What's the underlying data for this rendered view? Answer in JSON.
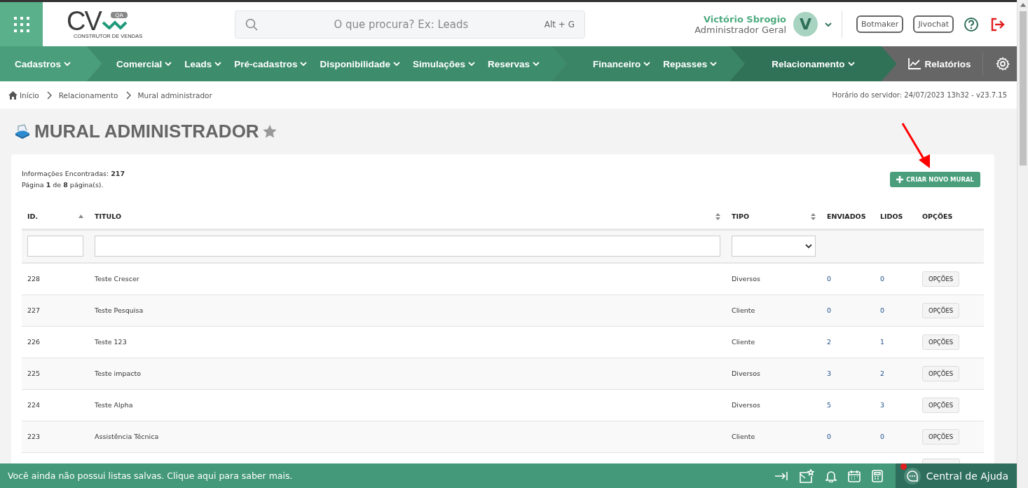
{
  "header": {
    "logo": {
      "mark": "CV",
      "badge": "QA",
      "tagline": "CONSTRUTOR DE VENDAS"
    },
    "search": {
      "placeholder": "O que procura? Ex: Leads",
      "shortcut": "Alt + G"
    },
    "user": {
      "name": "Victório Sbrogio",
      "role": "Administrador Geral",
      "initial": "V"
    },
    "buttons": [
      "Botmaker",
      "Jivochat"
    ]
  },
  "nav": {
    "groups": [
      {
        "items": [
          "Cadastros"
        ]
      },
      {
        "items": [
          "Comercial",
          "Leads",
          "Pré-cadastros",
          "Disponibilidade",
          "Simulações",
          "Reservas"
        ]
      },
      {
        "items": [
          "Financeiro",
          "Repasses"
        ]
      },
      {
        "items": [
          "Relacionamento"
        ]
      }
    ],
    "reports": "Relatórios"
  },
  "breadcrumb": [
    "Início",
    "Relacionamento",
    "Mural administrador"
  ],
  "server_time": "Horário do servidor: 24/07/2023 13h32 - v23.7.15",
  "page": {
    "title": "MURAL ADMINISTRADOR"
  },
  "summary": [
    "Informações Encontradas: **217**",
    "Página **1** de **8** página(s)."
  ],
  "create_button": "CRIAR NOVO MURAL",
  "table": {
    "columns": [
      {
        "label": "ID.",
        "sortable": true,
        "sorted_ascending": true,
        "filter": {
          "kind": "text"
        }
      },
      {
        "label": "TITULO",
        "sortable": true,
        "sorted_ascending": false,
        "filter": {
          "kind": "text"
        }
      },
      {
        "label": "TIPO",
        "sortable": true,
        "sorted_ascending": false,
        "filter": {
          "kind": "select"
        }
      },
      {
        "label": "ENVIADOS"
      },
      {
        "label": "LIDOS"
      },
      {
        "label": "OPÇÕES"
      }
    ],
    "rows": [
      {
        "id": "228",
        "title": "Teste Crescer",
        "type": "Diversos",
        "sent": "0",
        "read": "0",
        "options": "OPÇÕES"
      },
      {
        "id": "227",
        "title": "Teste Pesquisa",
        "type": "Cliente",
        "sent": "0",
        "read": "0",
        "options": "OPÇÕES"
      },
      {
        "id": "226",
        "title": "Teste 123",
        "type": "Cliente",
        "sent": "2",
        "read": "1",
        "options": "OPÇÕES"
      },
      {
        "id": "225",
        "title": "Teste impacto",
        "type": "Diversos",
        "sent": "3",
        "read": "2",
        "options": "OPÇÕES"
      },
      {
        "id": "224",
        "title": "Teste Alpha",
        "type": "Diversos",
        "sent": "5",
        "read": "3",
        "options": "OPÇÕES"
      },
      {
        "id": "223",
        "title": "Assistência Técnica",
        "type": "Cliente",
        "sent": "0",
        "read": "0",
        "options": "OPÇÕES"
      }
    ]
  },
  "bottom_bar": {
    "message": "Você ainda não possui listas salvas. Clique aqui para saber mais.",
    "help": "Central de Ajuda",
    "notification": true
  }
}
